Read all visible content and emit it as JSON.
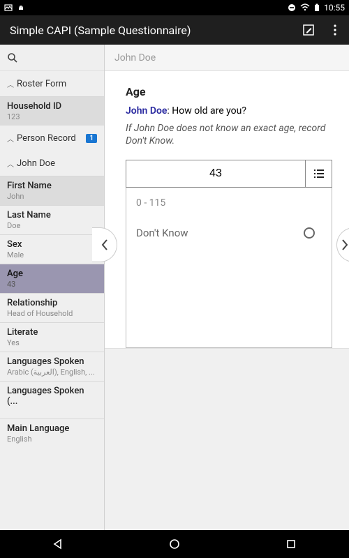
{
  "status": {
    "time": "10:55"
  },
  "app": {
    "title": "Simple CAPI (Sample Questionnaire)"
  },
  "breadcrumb": "John Doe",
  "sidebar": {
    "sections": {
      "roster": {
        "label": "Roster Form"
      },
      "person": {
        "label": "Person Record",
        "badge": "1"
      },
      "name_sec": {
        "label": "John Doe"
      }
    },
    "fields": {
      "household": {
        "label": "Household ID",
        "value": "123"
      },
      "first": {
        "label": "First Name",
        "value": "John"
      },
      "last": {
        "label": "Last Name",
        "value": "Doe"
      },
      "sex": {
        "label": "Sex",
        "value": "Male"
      },
      "age": {
        "label": "Age",
        "value": "43"
      },
      "rel": {
        "label": "Relationship",
        "value": "Head of Household"
      },
      "lit": {
        "label": "Literate",
        "value": "Yes"
      },
      "lang": {
        "label": "Languages Spoken",
        "value": "Arabic (العربية), English, ..."
      },
      "lang2": {
        "label": "Languages Spoken (...",
        "value": ""
      },
      "main": {
        "label": "Main Language",
        "value": "English"
      }
    }
  },
  "question": {
    "title": "Age",
    "subject": "John Doe",
    "prompt_rest": ": How old are you?",
    "note": "If John Doe does not know an exact age, record Don't Know.",
    "value": "43",
    "range_hint": "0 - 115",
    "options": {
      "dont_know": "Don't Know"
    }
  }
}
